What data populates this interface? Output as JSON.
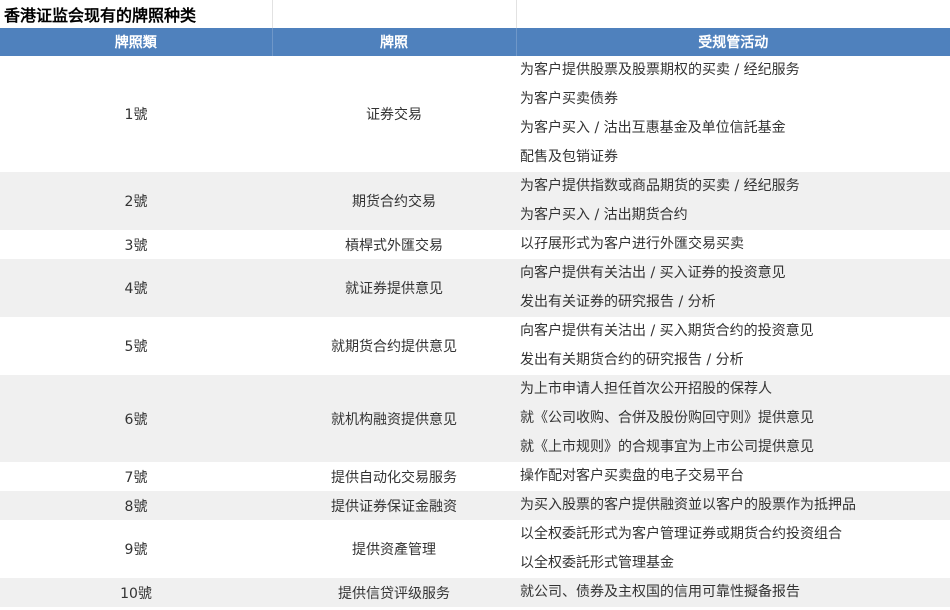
{
  "sheet_title": "香港证监会现有的牌照种类",
  "columns": {
    "type": "牌照類",
    "license": "牌照",
    "activities": "受规管活动"
  },
  "rows": [
    {
      "type": "1號",
      "license": "证券交易",
      "activities": [
        "为客户提供股票及股票期权的买卖 / 经纪服务",
        "为客户买卖债券",
        "为客户买入 / 沽出互惠基金及单位信託基金",
        "配售及包销证券"
      ]
    },
    {
      "type": "2號",
      "license": "期货合约交易",
      "activities": [
        "为客户提供指数或商品期货的买卖 / 经纪服务",
        "为客户买入 / 沽出期货合约"
      ]
    },
    {
      "type": "3號",
      "license": "槓桿式外匯交易",
      "activities": [
        "以孖展形式为客户进行外匯交易买卖"
      ]
    },
    {
      "type": "4號",
      "license": "就证券提供意见",
      "activities": [
        "向客户提供有关沽出 / 买入证券的投资意见",
        "发出有关证券的研究报告 / 分析"
      ]
    },
    {
      "type": "5號",
      "license": "就期货合约提供意见",
      "activities": [
        "向客户提供有关沽出 / 买入期货合约的投资意见",
        "发出有关期货合约的研究报告 / 分析"
      ]
    },
    {
      "type": "6號",
      "license": "就机构融资提供意见",
      "activities": [
        "为上市申请人担任首次公开招股的保荐人",
        "就《公司收购、合併及股份购回守则》提供意见",
        "就《上市规则》的合规事宜为上市公司提供意见"
      ]
    },
    {
      "type": "7號",
      "license": "提供自动化交易服务",
      "activities": [
        "操作配对客户买卖盘的电子交易平台"
      ]
    },
    {
      "type": "8號",
      "license": "提供证券保证金融资",
      "activities": [
        "为买入股票的客户提供融资並以客户的股票作为抵押品"
      ]
    },
    {
      "type": "9號",
      "license": "提供资產管理",
      "activities": [
        "以全权委託形式为客户管理证券或期货合约投资组合",
        "以全权委託形式管理基金"
      ]
    },
    {
      "type": "10號",
      "license": "提供信贷评级服务",
      "activities": [
        "就公司、债券及主权国的信用可靠性擬备报告"
      ]
    }
  ]
}
